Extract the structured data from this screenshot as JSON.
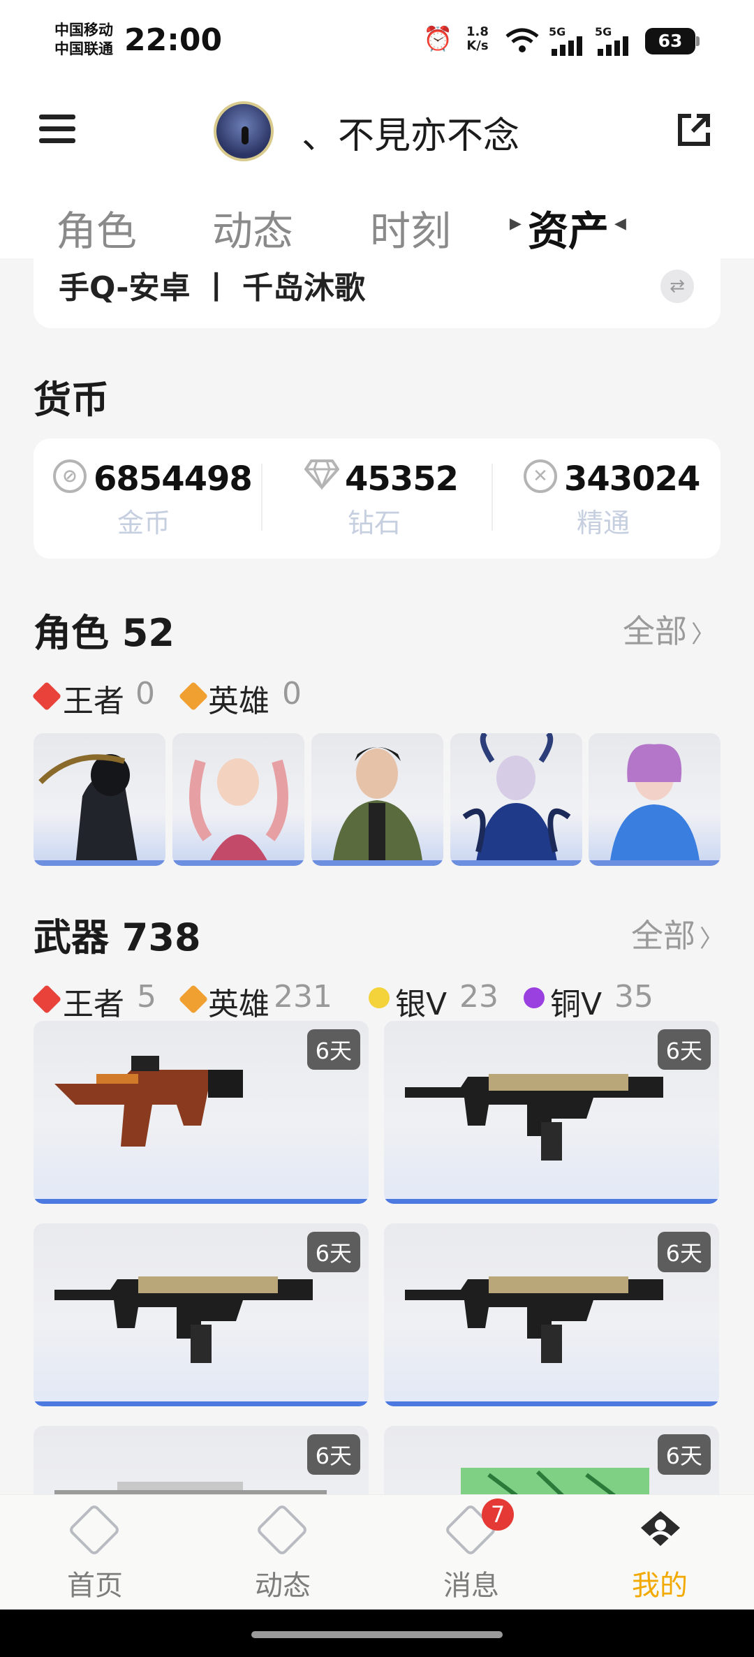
{
  "status_bar": {
    "carrier1": "中国移动",
    "carrier2": "中国联通",
    "time": "22:00",
    "net_speed_value": "1.8",
    "net_speed_unit": "K/s",
    "signal1": "5G",
    "signal2": "5G",
    "battery": "63"
  },
  "header": {
    "nickname": "、不見亦不念"
  },
  "tabs": [
    {
      "label": "角色"
    },
    {
      "label": "动态"
    },
    {
      "label": "时刻"
    },
    {
      "label": "资产"
    }
  ],
  "account": {
    "text": "手Q-安卓 丨 千岛沐歌"
  },
  "currency": {
    "title": "货币",
    "items": [
      {
        "value": "6854498",
        "label": "金币",
        "icon": "coin-icon"
      },
      {
        "value": "45352",
        "label": "钻石",
        "icon": "diamond-icon"
      },
      {
        "value": "343024",
        "label": "精通",
        "icon": "mastery-icon"
      }
    ]
  },
  "roles": {
    "title": "角色 52",
    "see_all": "全部",
    "tiers": [
      {
        "name": "王者",
        "count": "0",
        "color": "#e8423a"
      },
      {
        "name": "英雄",
        "count": "0",
        "color": "#f0a030"
      }
    ],
    "characters": [
      "masked-soldier",
      "pink-hair-girl",
      "green-jacket-man",
      "blue-armor-girl",
      "purple-hair-girl"
    ]
  },
  "weapons": {
    "title": "武器 738",
    "see_all": "全部",
    "tiers": [
      {
        "name": "王者",
        "count": "5",
        "color": "#e8423a"
      },
      {
        "name": "英雄",
        "count": "231",
        "color": "#f0a030"
      },
      {
        "name": "银V",
        "count": "23",
        "color": "#f3d23a"
      },
      {
        "name": "铜V",
        "count": "35",
        "color": "#9a3fe0"
      }
    ],
    "badge": "6天"
  },
  "bottom_nav": [
    {
      "label": "首页",
      "active": false
    },
    {
      "label": "动态",
      "active": false
    },
    {
      "label": "消息",
      "active": false,
      "badge": "7"
    },
    {
      "label": "我的",
      "active": true
    }
  ],
  "colors": {
    "accent": "#f2a900",
    "rank_bar": "#4b79e0",
    "badge": "#e53935"
  }
}
